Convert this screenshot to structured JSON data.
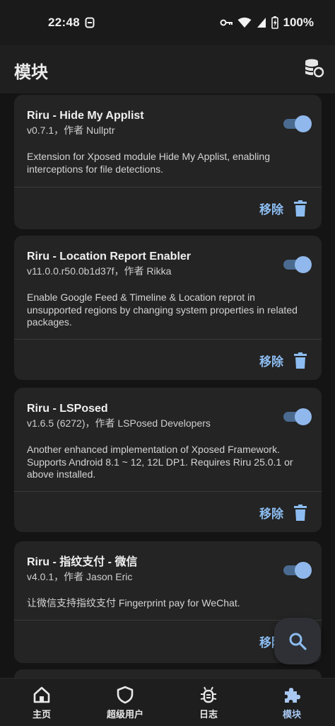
{
  "status_bar": {
    "time": "22:48",
    "left_icon": "face-id-icon",
    "right_icons": [
      "vpn-key-icon",
      "wifi-icon",
      "signal-icon",
      "battery-charging-icon"
    ],
    "battery": "100%"
  },
  "app_bar": {
    "title": "模块",
    "action_icon": "backup-restore-icon"
  },
  "modules": [
    {
      "name": "Riru - Hide My Applist",
      "version": "v0.7.1，作者 Nullptr",
      "description": "Extension for Xposed module Hide My Applist, enabling interceptions for file detections.",
      "enabled": true,
      "remove_label": "移除"
    },
    {
      "name": "Riru - Location Report Enabler",
      "version": "v11.0.0.r50.0b1d37f，作者 Rikka",
      "description": "Enable Google Feed & Timeline & Location reprot in unsupported regions by changing system properties in related packages.",
      "enabled": true,
      "remove_label": "移除"
    },
    {
      "name": "Riru - LSPosed",
      "version": "v1.6.5 (6272)，作者 LSPosed Developers",
      "description": "Another enhanced implementation of Xposed Framework. Supports Android 8.1 ~ 12, 12L DP1. Requires Riru 25.0.1 or above installed.",
      "enabled": true,
      "remove_label": "移除"
    },
    {
      "name": "Riru - 指纹支付 - 微信",
      "version": "v4.0.1，作者 Jason Eric",
      "description": "让微信支持指纹支付 Fingerprint pay for WeChat.",
      "enabled": true,
      "remove_label": "移除"
    }
  ],
  "fab": {
    "icon": "search-icon"
  },
  "bottom_nav": {
    "items": [
      {
        "label": "主页",
        "icon": "home-icon",
        "active": false
      },
      {
        "label": "超级用户",
        "icon": "shield-icon",
        "active": false
      },
      {
        "label": "日志",
        "icon": "bug-icon",
        "active": false
      },
      {
        "label": "模块",
        "icon": "extension-icon",
        "active": true
      }
    ]
  },
  "colors": {
    "background": "#141414",
    "card": "#242424",
    "accent": "#8cbcf0",
    "toggle_track": "#4a6a90",
    "toggle_thumb": "#90b8ec"
  }
}
